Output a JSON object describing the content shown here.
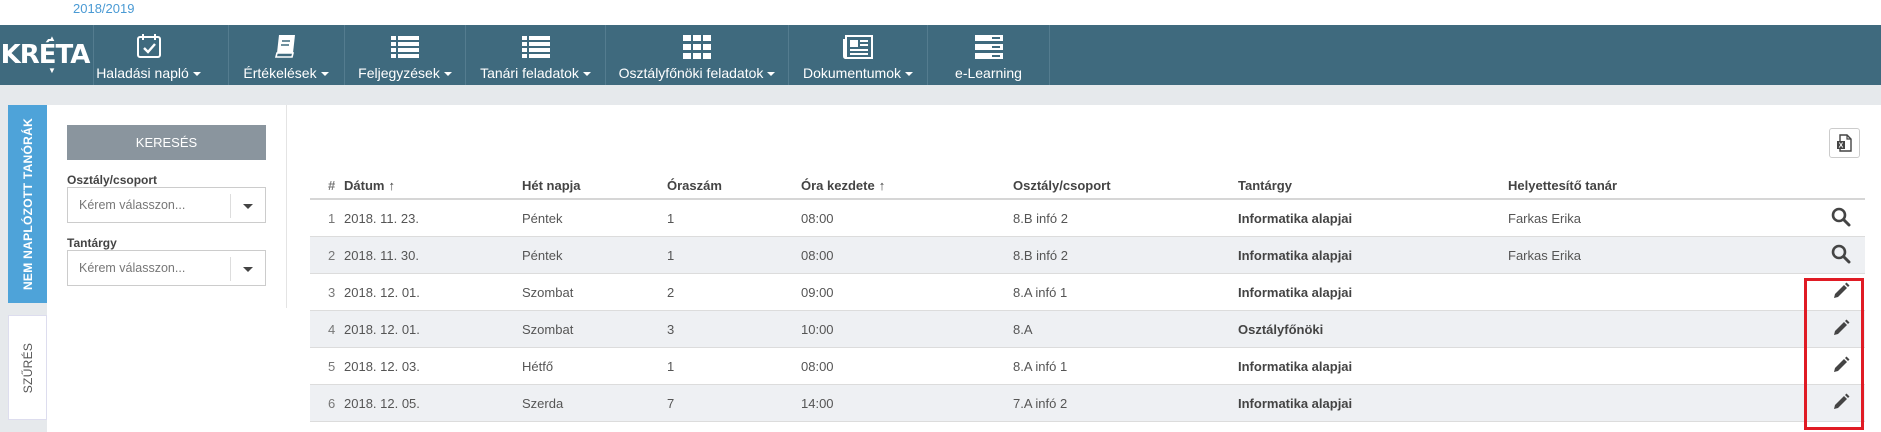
{
  "header": {
    "school_year": "2018/2019"
  },
  "logo": {
    "text": "KRÉTA"
  },
  "nav": [
    {
      "label": "Haladási napló",
      "icon": "calendar-check-icon",
      "dropdown": true
    },
    {
      "label": "Értékelések",
      "icon": "book-icon",
      "dropdown": true
    },
    {
      "label": "Feljegyzések",
      "icon": "list-icon",
      "dropdown": true
    },
    {
      "label": "Tanári feladatok",
      "icon": "list-icon",
      "dropdown": true
    },
    {
      "label": "Osztályfőnöki feladatok",
      "icon": "grid-icon",
      "dropdown": true
    },
    {
      "label": "Dokumentumok",
      "icon": "newspaper-icon",
      "dropdown": true
    },
    {
      "label": "e-Learning",
      "icon": "server-icon",
      "dropdown": false
    }
  ],
  "side_tabs": {
    "active": "NEM NAPLÓZOTT TANÓRÁK",
    "filter": "SZŰRÉS"
  },
  "filters": {
    "search_button": "KERESÉS",
    "class_label": "Osztály/csoport",
    "class_placeholder": "Kérem válasszon...",
    "subject_label": "Tantárgy",
    "subject_placeholder": "Kérem válasszon..."
  },
  "table": {
    "columns": {
      "num": "#",
      "date": "Dátum",
      "weekday": "Hét napja",
      "period": "Óraszám",
      "start": "Óra kezdete",
      "group": "Osztály/csoport",
      "subject": "Tantárgy",
      "substitute": "Helyettesítő tanár"
    },
    "sort_arrow": "↑",
    "rows": [
      {
        "num": "1",
        "date": "2018. 11. 23.",
        "weekday": "Péntek",
        "period": "1",
        "start": "08:00",
        "group": "8.B infó 2",
        "subject": "Informatika alapjai",
        "substitute": "Farkas Erika",
        "action": "search-icon"
      },
      {
        "num": "2",
        "date": "2018. 11. 30.",
        "weekday": "Péntek",
        "period": "1",
        "start": "08:00",
        "group": "8.B infó 2",
        "subject": "Informatika alapjai",
        "substitute": "Farkas Erika",
        "action": "search-icon"
      },
      {
        "num": "3",
        "date": "2018. 12. 01.",
        "weekday": "Szombat",
        "period": "2",
        "start": "09:00",
        "group": "8.A infó 1",
        "subject": "Informatika alapjai",
        "substitute": "",
        "action": "pencil-icon"
      },
      {
        "num": "4",
        "date": "2018. 12. 01.",
        "weekday": "Szombat",
        "period": "3",
        "start": "10:00",
        "group": "8.A",
        "subject": "Osztályfőnöki",
        "substitute": "",
        "action": "pencil-icon"
      },
      {
        "num": "5",
        "date": "2018. 12. 03.",
        "weekday": "Hétfő",
        "period": "1",
        "start": "08:00",
        "group": "8.A infó 1",
        "subject": "Informatika alapjai",
        "substitute": "",
        "action": "pencil-icon"
      },
      {
        "num": "6",
        "date": "2018. 12. 05.",
        "weekday": "Szerda",
        "period": "7",
        "start": "14:00",
        "group": "7.A infó 2",
        "subject": "Informatika alapjai",
        "substitute": "",
        "action": "pencil-icon"
      }
    ]
  },
  "colors": {
    "navbar": "#3f6a7e",
    "active_tab": "#4ea3d9",
    "highlight": "#e01b24"
  }
}
